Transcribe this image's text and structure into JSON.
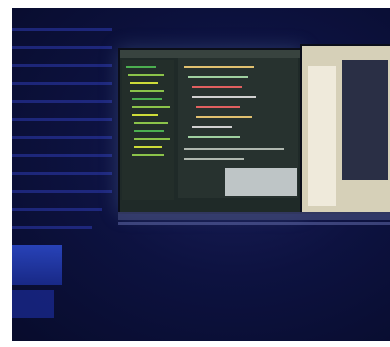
{
  "scene": {
    "description_colors": {
      "room": "#0a0f33",
      "blinds": "#2d3bb0",
      "ide_bg": "#1f2a28",
      "right_screen": "#d6d0b8"
    }
  }
}
